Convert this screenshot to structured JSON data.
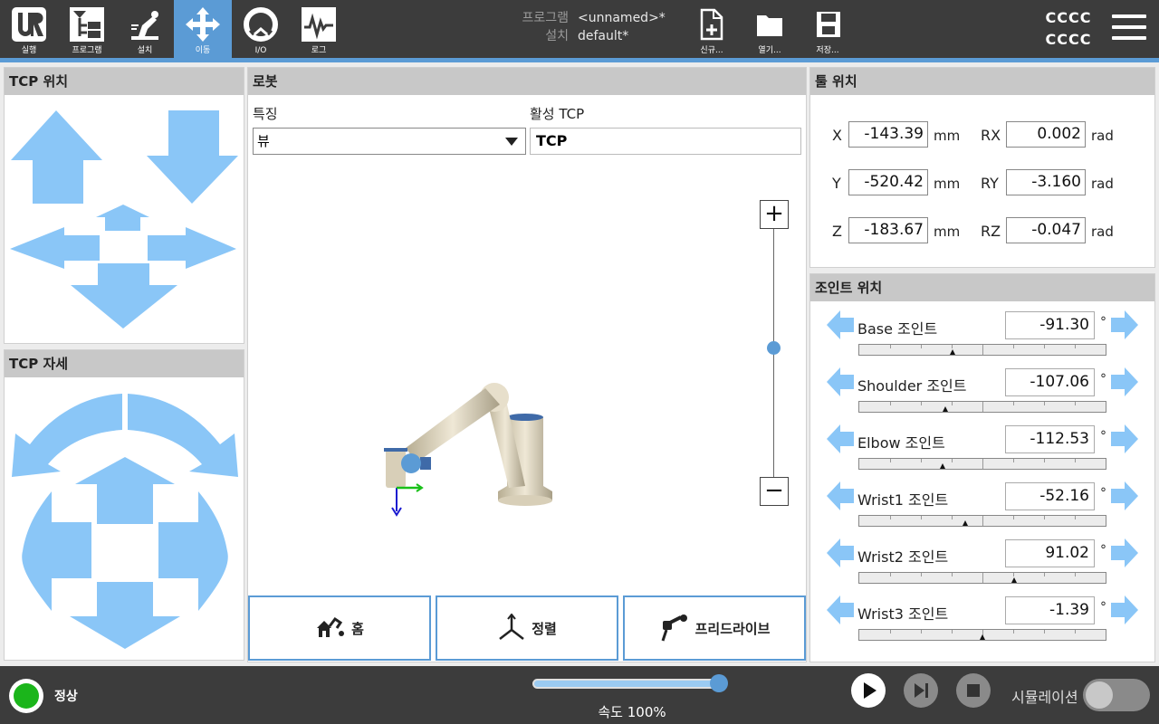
{
  "nav": {
    "items": [
      {
        "label": "실행",
        "icon": "ur-logo-icon"
      },
      {
        "label": "프로그램",
        "icon": "program-tree-icon"
      },
      {
        "label": "설치",
        "icon": "robot-install-icon"
      },
      {
        "label": "이동",
        "icon": "move-arrows-icon",
        "active": true
      },
      {
        "label": "I/O",
        "icon": "io-icon"
      },
      {
        "label": "로그",
        "icon": "log-icon"
      }
    ]
  },
  "program": {
    "program_key": "프로그램",
    "program_value": "<unnamed>*",
    "install_key": "설치",
    "install_value": "default*"
  },
  "file": {
    "new_label": "신규...",
    "open_label": "열기...",
    "save_label": "저장..."
  },
  "header_right": {
    "line1": "CCCC",
    "line2": "CCCC"
  },
  "tcp_position": {
    "title": "TCP 위치"
  },
  "tcp_orientation": {
    "title": "TCP 자세"
  },
  "robot": {
    "title": "로봇",
    "feature_label": "특징",
    "feature_value": "뷰",
    "active_tcp_label": "활성 TCP",
    "active_tcp_value": "TCP",
    "zoom_in": "+",
    "zoom_out": "−",
    "home_label": "홈",
    "align_label": "정렬",
    "freedrive_label": "프리드라이브"
  },
  "tool_position": {
    "title": "툴 위치",
    "x_label": "X",
    "x_value": "-143.39",
    "x_unit": "mm",
    "y_label": "Y",
    "y_value": "-520.42",
    "y_unit": "mm",
    "z_label": "Z",
    "z_value": "-183.67",
    "z_unit": "mm",
    "rx_label": "RX",
    "rx_value": "0.002",
    "rx_unit": "rad",
    "ry_label": "RY",
    "ry_value": "-3.160",
    "ry_unit": "rad",
    "rz_label": "RZ",
    "rz_value": "-0.047",
    "rz_unit": "rad"
  },
  "joint_position": {
    "title": "조인트 위치",
    "unit": "°",
    "joints": [
      {
        "name": "Base 조인트",
        "value": "-91.30",
        "fraction": 0.38
      },
      {
        "name": "Shoulder 조인트",
        "value": "-107.06",
        "fraction": 0.35
      },
      {
        "name": "Elbow 조인트",
        "value": "-112.53",
        "fraction": 0.34
      },
      {
        "name": "Wrist1 조인트",
        "value": "-52.16",
        "fraction": 0.43
      },
      {
        "name": "Wrist2 조인트",
        "value": "91.02",
        "fraction": 0.63
      },
      {
        "name": "Wrist3 조인트",
        "value": "-1.39",
        "fraction": 0.5
      }
    ]
  },
  "status": {
    "label": "정상",
    "color": "#1bb51b"
  },
  "speed": {
    "label": "속도 100%",
    "percent": 100
  },
  "simulation": {
    "label": "시뮬레이션",
    "enabled": false
  },
  "colors": {
    "accent": "#5b9bd5",
    "arrow": "#8ac6f7",
    "topbar": "#3c3c3c"
  }
}
